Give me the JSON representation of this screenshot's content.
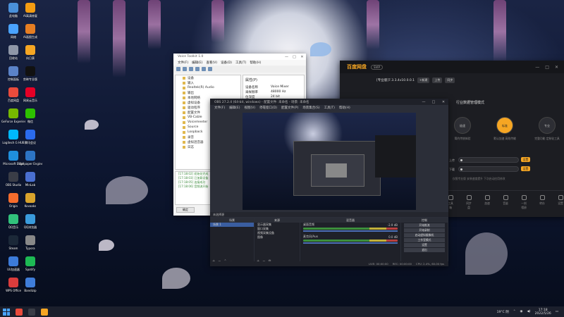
{
  "desktop": {
    "icons": [
      {
        "label": "此电脑",
        "color": "#4a90d9"
      },
      {
        "label": "网络",
        "color": "#4aa3ff"
      },
      {
        "label": "回收站",
        "color": "#8f97a8"
      },
      {
        "label": "控制面板",
        "color": "#5b83c8"
      },
      {
        "label": "百度网盘",
        "color": "#e94b3c"
      },
      {
        "label": "GeForce Experience",
        "color": "#76b900"
      },
      {
        "label": "Logitech G HUB",
        "color": "#00b8fc"
      },
      {
        "label": "Microsoft Edge",
        "color": "#1f8fdc"
      },
      {
        "label": "OBS Studio",
        "color": "#3a3d47"
      },
      {
        "label": "Origin",
        "color": "#f56c2d"
      },
      {
        "label": "QQ音乐",
        "color": "#31c27c"
      },
      {
        "label": "Steam",
        "color": "#1b2838"
      },
      {
        "label": "UU加速器",
        "color": "#3c7bd9"
      },
      {
        "label": "WPS Office",
        "color": "#d93c3c"
      },
      {
        "label": "AI高清修复",
        "color": "#f39c12"
      },
      {
        "label": "AI画图生成",
        "color": "#e67e22"
      },
      {
        "label": "向日葵",
        "color": "#f6a623"
      },
      {
        "label": "剪映专业版",
        "color": "#111111"
      },
      {
        "label": "网易云音乐",
        "color": "#e60026"
      },
      {
        "label": "微信",
        "color": "#2dc100"
      },
      {
        "label": "腾讯会议",
        "color": "#2b6bed"
      },
      {
        "label": "Wallpaper Engine",
        "color": "#2d74c4"
      },
      {
        "label": "MinLab",
        "color": "#4a6fd0"
      },
      {
        "label": "Kovaaks",
        "color": "#d9a32c"
      },
      {
        "label": "QQ浏览器",
        "color": "#3a9bdc"
      },
      {
        "label": "Typora",
        "color": "#888888"
      },
      {
        "label": "Spotify",
        "color": "#1db954"
      },
      {
        "label": "Bandizip",
        "color": "#3f7dd9"
      }
    ]
  },
  "win_tool": {
    "title": "Voice Toolkit 1.0",
    "menus": [
      "文件(F)",
      "编辑(E)",
      "查看(V)",
      "设备(D)",
      "工具(T)",
      "帮助(H)"
    ],
    "tree": [
      "设备",
      "输入",
      "Realtek(R) Audio",
      "输出",
      "本地网络",
      "虚拟设备",
      "驱动程序",
      "配置文件",
      "VB-Cable",
      "Voicemeeter",
      "Source",
      "Loopback",
      "录音",
      "虚拟混音器",
      "日志"
    ],
    "panel_title": "属性(P)",
    "props": [
      [
        "设备名称",
        "Voice Mixer"
      ],
      [
        "采样频率",
        "48000 Hz"
      ],
      [
        "位深度",
        "24 bit"
      ],
      [
        "通道",
        "2"
      ]
    ],
    "log_lines": [
      "[17:18:02] 初始化完成",
      "[17:18:03] 已加载设备",
      "[17:18:05] 连接成功",
      "[17:18:06] 音频流开始"
    ],
    "status_button": "确定"
  },
  "win_dark": {
    "logo": "百度网盘",
    "pill": "SVIP",
    "ctrls": [
      "—",
      "□",
      "✕"
    ],
    "nav_title": "[专业版]7.3.3.4v10.0.0.1",
    "nav_buttons": [
      "+新建",
      "上传",
      "同步"
    ],
    "section": "行业数据管理模式",
    "modes": [
      {
        "label": "极速",
        "sub": "简约传统体验",
        "on": false
      },
      {
        "label": "标准",
        "sub": "默认加速 高效传输",
        "on": true
      },
      {
        "label": "专业",
        "sub": "完整功能 定制化工具",
        "on": false
      }
    ],
    "sliders": [
      {
        "label": "上传",
        "button": "设置"
      },
      {
        "label": "下载",
        "button": "设置"
      }
    ],
    "note": "仅限专业版  安装速度提升  下次启动应用修改",
    "bottom": [
      "工具箱",
      "同步盘",
      "加速",
      "音量",
      "一刻相册",
      "转存",
      "设置"
    ]
  },
  "win_obs": {
    "title": "OBS 27.2.4 (64-bit, windows) - 配置文件: 未命名 - 场景: 未命名",
    "menus": [
      "文件(F)",
      "编辑(E)",
      "视图(V)",
      "停靠窗口(D)",
      "配置文件(P)",
      "场景集合(S)",
      "工具(T)",
      "帮助(H)"
    ],
    "preview_label": "未选择源",
    "panels": {
      "scenes": {
        "title": "场景",
        "items": [
          "场景 1"
        ]
      },
      "sources": {
        "title": "来源",
        "items": [
          "显示器采集",
          "窗口采集",
          "视频采集设备",
          "图像"
        ]
      },
      "mixer": {
        "title": "混音器",
        "channels": [
          {
            "name": "桌面音频",
            "db": "-2.9 dB"
          },
          {
            "name": "麦克风/Aux",
            "db": "0.0 dB"
          }
        ]
      },
      "transitions": {
        "title": "场景过渡",
        "type": "淡入淡出",
        "duration": "300 ms"
      },
      "controls": {
        "title": "控制",
        "buttons": [
          "开始推流",
          "开始录制",
          "启动虚拟摄像机",
          "工作室模式",
          "设置",
          "退出"
        ]
      }
    },
    "status": [
      "LIVE: 00:00:00",
      "REC: 00:00:00",
      "CPU: 2.4%, 60.00 fps"
    ],
    "bottom_buttons": [
      "应用",
      "取消"
    ]
  },
  "taskbar": {
    "apps": [
      {
        "color": "#e94b3c"
      },
      {
        "color": "#3a3d47"
      },
      {
        "color": "#f6a623"
      }
    ],
    "weather": "19°C 阴",
    "time": "17:18",
    "date": "2022/5/26"
  }
}
